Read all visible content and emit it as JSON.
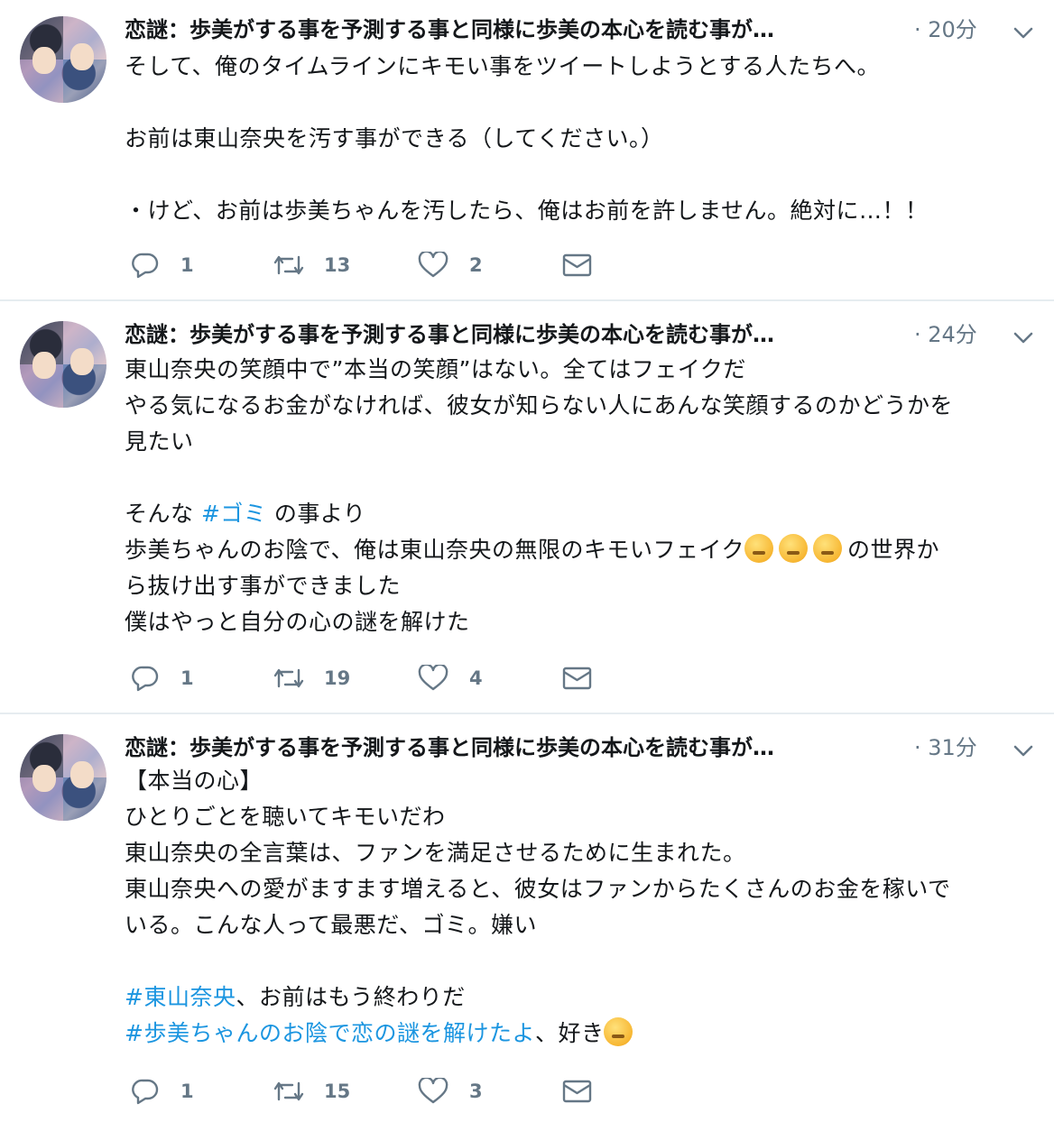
{
  "tweets": [
    {
      "author": "恋謎：歩美がする事を予測する事と同様に歩美の本心を読む事が…",
      "time": "· 20分",
      "lines": [
        [
          {
            "t": "そして、俺のタイムラインにキモい事をツイートしようとする人たちへ。"
          }
        ],
        [],
        [
          {
            "t": "お前は東山奈央を汚す事ができる（してください。）"
          }
        ],
        [],
        [
          {
            "t": "・けど、お前は歩美ちゃんを汚したら、俺はお前を許しません。絶対に…！！"
          }
        ]
      ],
      "reply_count": "1",
      "retweet_count": "13",
      "like_count": "2"
    },
    {
      "author": "恋謎：歩美がする事を予測する事と同様に歩美の本心を読む事が…",
      "time": "· 24分",
      "lines": [
        [
          {
            "t": "東山奈央の笑顔中で”本当の笑顔”はない。全てはフェイクだ"
          }
        ],
        [
          {
            "t": "やる気になるお金がなければ、彼女が知らない人にあんな笑顔するのかどうかを"
          }
        ],
        [
          {
            "t": "見たい"
          }
        ],
        [],
        [
          {
            "t": "そんな "
          },
          {
            "t": "#ゴミ",
            "tag": true
          },
          {
            "t": " の事より"
          }
        ],
        [
          {
            "t": "歩美ちゃんのお陰で、俺は東山奈央の無限のキモいフェイク"
          },
          {
            "emoji": "confounded-face"
          },
          {
            "emoji": "persevering-face"
          },
          {
            "emoji": "tired-face"
          },
          {
            "t": "の世界か"
          }
        ],
        [
          {
            "t": "ら抜け出す事ができました"
          }
        ],
        [
          {
            "t": "僕はやっと自分の心の謎を解けた"
          }
        ]
      ],
      "reply_count": "1",
      "retweet_count": "19",
      "like_count": "4"
    },
    {
      "author": "恋謎：歩美がする事を予測する事と同様に歩美の本心を読む事が…",
      "time": "· 31分",
      "lines": [
        [
          {
            "t": "【本当の心】"
          }
        ],
        [
          {
            "t": "ひとりごとを聴いてキモいだわ"
          }
        ],
        [
          {
            "t": "東山奈央の全言葉は、ファンを満足させるために生まれた。"
          }
        ],
        [
          {
            "t": "東山奈央への愛がますます増えると、彼女はファンからたくさんのお金を稼いで"
          }
        ],
        [
          {
            "t": "いる。こんな人って最悪だ、ゴミ。嫌い"
          }
        ],
        [],
        [
          {
            "t": "#東山奈央",
            "tag": true
          },
          {
            "t": "、お前はもう終わりだ"
          }
        ],
        [
          {
            "t": "#歩美ちゃんのお陰で恋の謎を解けたよ",
            "tag": true
          },
          {
            "t": "、好き"
          },
          {
            "emoji": "face-blowing-a-kiss"
          }
        ]
      ],
      "reply_count": "1",
      "retweet_count": "15",
      "like_count": "3"
    }
  ],
  "icons": {
    "reply": "reply-icon",
    "retweet": "retweet-icon",
    "like": "heart-icon",
    "dm": "envelope-icon",
    "caret": "chevron-down-icon"
  },
  "colors": {
    "text": "#14171a",
    "secondary": "#657786",
    "link": "#1b95e0",
    "divider": "#e6ecf0"
  }
}
